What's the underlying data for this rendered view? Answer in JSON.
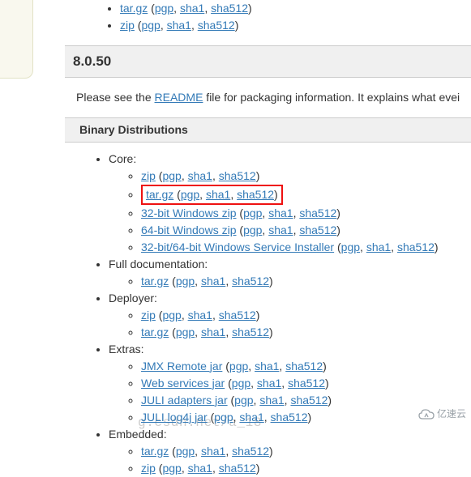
{
  "top_bullets": [
    {
      "main": "tar.gz",
      "sigs": [
        "pgp",
        "sha1",
        "sha512"
      ]
    },
    {
      "main": "zip",
      "sigs": [
        "pgp",
        "sha1",
        "sha512"
      ]
    }
  ],
  "version_header": "8.0.50",
  "intro_pre": "Please see the ",
  "intro_link": "README",
  "intro_post": " file for packaging information. It explains what evei",
  "section_header": "Binary Distributions",
  "groups": [
    {
      "label": "Core:",
      "items": [
        {
          "main": "zip",
          "sigs": [
            "pgp",
            "sha1",
            "sha512"
          ],
          "highlight": false
        },
        {
          "main": "tar.gz",
          "sigs": [
            "pgp",
            "sha1",
            "sha512"
          ],
          "highlight": true
        },
        {
          "main": "32-bit Windows zip",
          "sigs": [
            "pgp",
            "sha1",
            "sha512"
          ],
          "highlight": false
        },
        {
          "main": "64-bit Windows zip",
          "sigs": [
            "pgp",
            "sha1",
            "sha512"
          ],
          "highlight": false
        },
        {
          "main": "32-bit/64-bit Windows Service Installer",
          "sigs": [
            "pgp",
            "sha1",
            "sha512"
          ],
          "highlight": false
        }
      ]
    },
    {
      "label": "Full documentation:",
      "items": [
        {
          "main": "tar.gz",
          "sigs": [
            "pgp",
            "sha1",
            "sha512"
          ],
          "highlight": false
        }
      ]
    },
    {
      "label": "Deployer:",
      "items": [
        {
          "main": "zip",
          "sigs": [
            "pgp",
            "sha1",
            "sha512"
          ],
          "highlight": false
        },
        {
          "main": "tar.gz",
          "sigs": [
            "pgp",
            "sha1",
            "sha512"
          ],
          "highlight": false
        }
      ]
    },
    {
      "label": "Extras:",
      "items": [
        {
          "main": "JMX Remote jar",
          "sigs": [
            "pgp",
            "sha1",
            "sha512"
          ],
          "highlight": false
        },
        {
          "main": "Web services jar",
          "sigs": [
            "pgp",
            "sha1",
            "sha512"
          ],
          "highlight": false
        },
        {
          "main": "JULI adapters jar",
          "sigs": [
            "pgp",
            "sha1",
            "sha512"
          ],
          "highlight": false
        },
        {
          "main": "JULI log4j jar",
          "sigs": [
            "pgp",
            "sha1",
            "sha512"
          ],
          "highlight": false
        }
      ]
    },
    {
      "label": "Embedded:",
      "items": [
        {
          "main": "tar.gz",
          "sigs": [
            "pgp",
            "sha1",
            "sha512"
          ],
          "highlight": false
        },
        {
          "main": "zip",
          "sigs": [
            "pgp",
            "sha1",
            "sha512"
          ],
          "highlight": false
        }
      ]
    }
  ],
  "watermark": "g.csdn.net/a_18",
  "cloud_label": "亿速云"
}
